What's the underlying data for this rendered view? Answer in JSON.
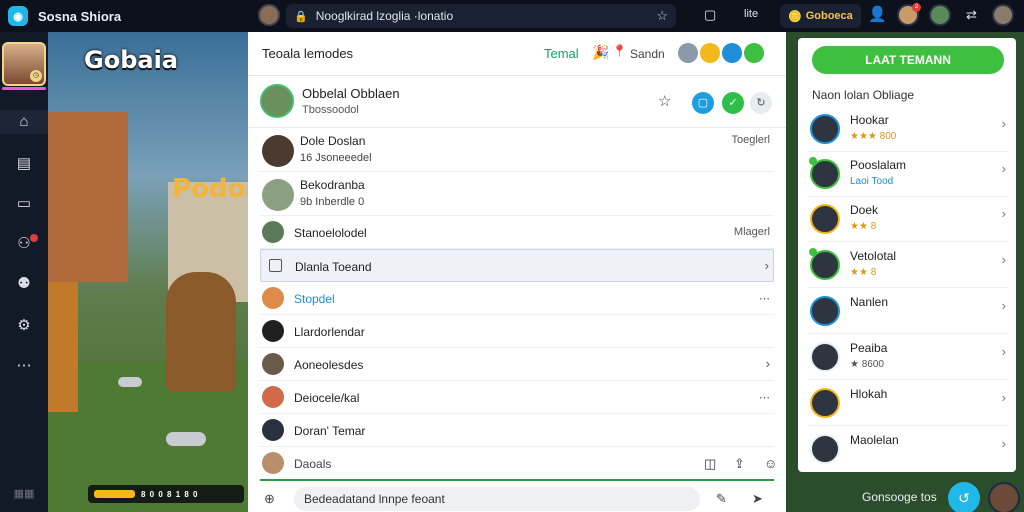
{
  "topbar": {
    "app_name": "Sosna Shiora",
    "url": "Nooglkirad lzoglia ·lonatio",
    "coins": "Goboeca",
    "bell_badge": "2"
  },
  "game": {
    "title": "Gobaia",
    "sign": "Podoa",
    "xp_fill": 0.26,
    "xp_stats": "8 0 0 8 1 8 0"
  },
  "center": {
    "header_title": "Teoala lemodes",
    "header_tab": "Temal",
    "header_sub": "Sandn",
    "open_chat": {
      "name": "Obbelal Obblaen",
      "status": "Tbossoodol"
    },
    "rows": [
      {
        "name": "Dole Doslan",
        "status": "16 Jsoneeedel",
        "right": "Toeglerl"
      },
      {
        "name": "Bekodranba",
        "status": "9b Inberdle 0"
      },
      {
        "name": "Stanoelolodel",
        "right": "Mlagerl"
      },
      {
        "name": "Dlanla Toeand"
      },
      {
        "name": "Stopdel"
      },
      {
        "name": "Llardorlendar"
      },
      {
        "name": "Aoneolesdes"
      },
      {
        "name": "Deiocele/kal"
      },
      {
        "name": "Doran' Temar"
      }
    ],
    "composer_name": "Daoals",
    "composer_placeholder": "Bedeadatand lnnpe feoant"
  },
  "right": {
    "add_button": "LAAT TEMANN",
    "section_title": "Naon lolan Obliage",
    "friends": [
      {
        "name": "Hookar",
        "status": "★★★ 800"
      },
      {
        "name": "Pooslalam",
        "status": "Laoi Tood"
      },
      {
        "name": "Doek",
        "status": "★★ 8"
      },
      {
        "name": "Vetolotal",
        "status": "★★ 8"
      },
      {
        "name": "Nanlen",
        "status": ""
      },
      {
        "name": "Peaiba",
        "status": "★ 8600"
      },
      {
        "name": "Hlokah",
        "status": ""
      },
      {
        "name": "Maolelan",
        "status": ""
      }
    ],
    "footer_greeting": "Gonsooge tos"
  },
  "colors": {
    "accent_green": "#3fbf3f",
    "accent_blue": "#20b8e8",
    "gold": "#f3b81c"
  }
}
